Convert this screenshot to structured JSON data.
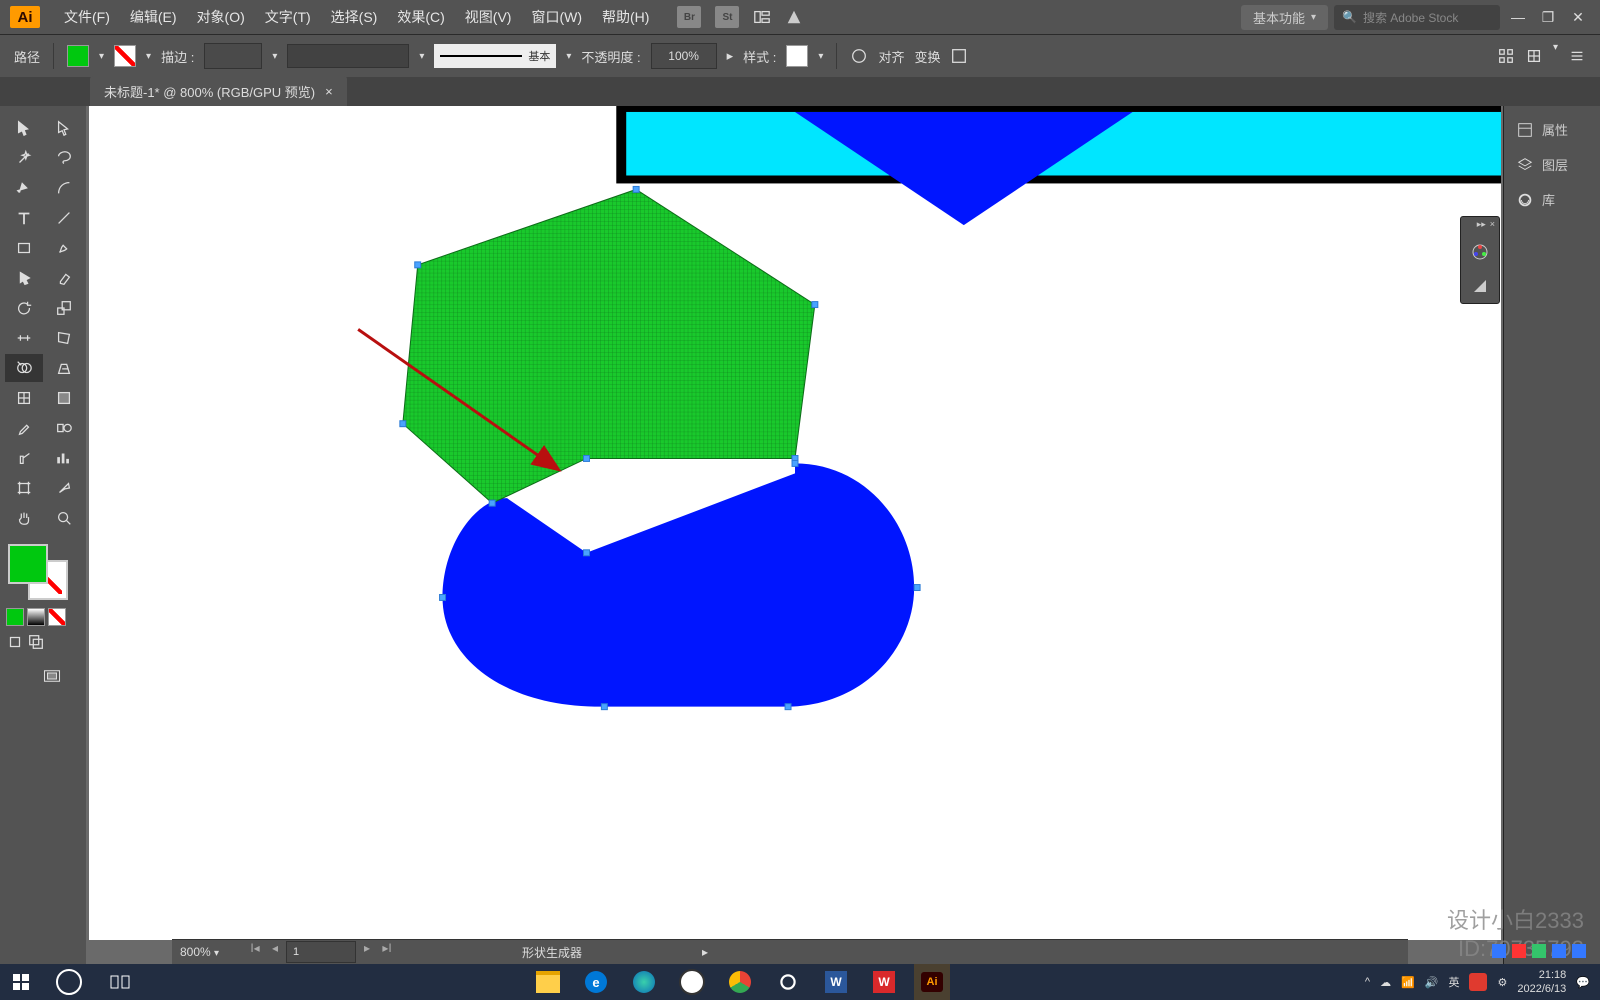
{
  "menu": {
    "items": [
      "文件(F)",
      "编辑(E)",
      "对象(O)",
      "文字(T)",
      "选择(S)",
      "效果(C)",
      "视图(V)",
      "窗口(W)",
      "帮助(H)"
    ]
  },
  "workspace_label": "基本功能",
  "search_placeholder": "搜索 Adobe Stock",
  "options": {
    "path_label": "路径",
    "stroke_label": "描边 :",
    "stroke_value": "",
    "preset_label": "基本",
    "opacity_label": "不透明度 :",
    "opacity_value": "100%",
    "style_label": "样式 :",
    "align_label": "对齐",
    "transform_label": "变换"
  },
  "document_tab": "未标题-1* @ 800% (RGB/GPU 预览)",
  "right_panels": [
    "属性",
    "图层",
    "库"
  ],
  "status": {
    "zoom": "800%",
    "artboard": "1",
    "tool": "形状生成器"
  },
  "float_panel_title": "颜色",
  "clock": {
    "time": "21:18",
    "date": "2022/6/13",
    "ime": "英"
  },
  "watermark": {
    "l1": "设计小白2333",
    "l2": "ID:70735793"
  },
  "colors": {
    "fill": "#00c80f",
    "cyan": "#00e6ff",
    "blue": "#0015ff",
    "arrow": "#b80f0f"
  }
}
